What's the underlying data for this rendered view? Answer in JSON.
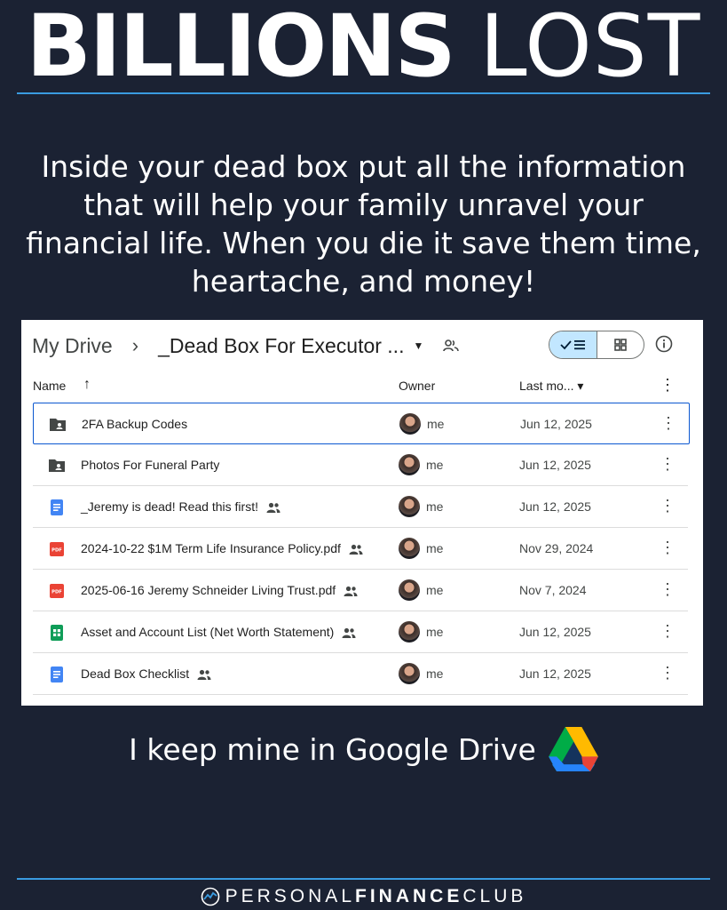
{
  "headline": {
    "bold": "BILLIONS",
    "light": "LOST"
  },
  "intro": "Inside your dead box put all the information that will help your family unravel your financial life. When you die it save them time, heartache, and money!",
  "drive": {
    "breadcrumb_root": "My Drive",
    "breadcrumb_sep": "›",
    "breadcrumb_current": "_Dead Box For Executor ...",
    "columns": {
      "name": "Name",
      "sort_arrow": "↑",
      "owner": "Owner",
      "modified": "Last mo... ▾"
    },
    "files": [
      {
        "name": "2FA Backup Codes",
        "type": "shared-folder",
        "shared": false,
        "owner": "me",
        "modified": "Jun 12, 2025"
      },
      {
        "name": "Photos For Funeral Party",
        "type": "shared-folder",
        "shared": false,
        "owner": "me",
        "modified": "Jun 12, 2025"
      },
      {
        "name": "_Jeremy is dead! Read this first!",
        "type": "doc",
        "shared": true,
        "owner": "me",
        "modified": "Jun 12, 2025"
      },
      {
        "name": "2024-10-22 $1M Term Life Insurance Policy.pdf",
        "type": "pdf",
        "shared": true,
        "owner": "me",
        "modified": "Nov 29, 2024"
      },
      {
        "name": "2025-06-16 Jeremy Schneider Living Trust.pdf",
        "type": "pdf",
        "shared": true,
        "owner": "me",
        "modified": "Nov 7, 2024"
      },
      {
        "name": "Asset and Account List (Net Worth Statement)",
        "type": "sheet",
        "shared": true,
        "owner": "me",
        "modified": "Jun 12, 2025"
      },
      {
        "name": "Dead Box Checklist",
        "type": "doc",
        "shared": true,
        "owner": "me",
        "modified": "Jun 12, 2025"
      }
    ]
  },
  "footer_text": "I keep mine in Google Drive",
  "brand": {
    "part1": "PERSONAL",
    "part2": "FINANCE",
    "part3": "CLUB"
  },
  "colors": {
    "background": "#1b2233",
    "accent_rule": "#3a9be0",
    "selected_border": "#0b57d0",
    "toggle_active": "#c2e7ff"
  }
}
